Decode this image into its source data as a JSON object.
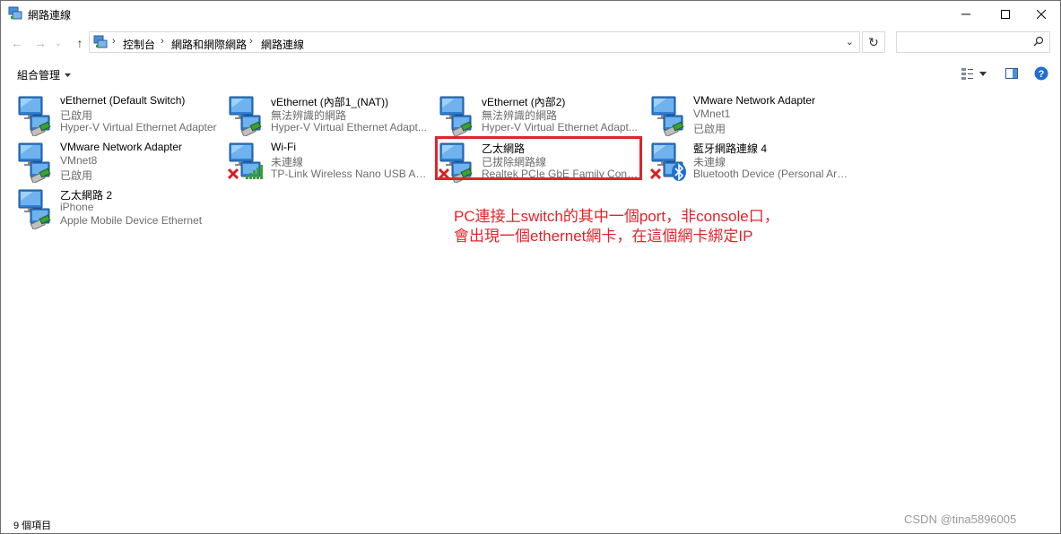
{
  "window": {
    "title": "網路連線",
    "minimize_icon": "minimize-icon",
    "maximize_icon": "maximize-icon",
    "close_icon": "close-icon"
  },
  "address_bar": {
    "breadcrumbs": [
      "控制台",
      "網路和網際網路",
      "網路連線"
    ],
    "search_placeholder": ""
  },
  "toolbar": {
    "organize_label": "組合管理"
  },
  "connections": [
    {
      "name": "vEthernet (Default Switch)",
      "status": "已啟用",
      "device": "Hyper-V Virtual Ethernet Adapter",
      "type": "ethernet",
      "overlay": ""
    },
    {
      "name": "vEthernet (內部1_(NAT))",
      "status": "無法辨識的網路",
      "device": "Hyper-V Virtual Ethernet Adapt...",
      "type": "ethernet",
      "overlay": ""
    },
    {
      "name": "vEthernet (內部2)",
      "status": "無法辨識的網路",
      "device": "Hyper-V Virtual Ethernet Adapt...",
      "type": "ethernet",
      "overlay": ""
    },
    {
      "name": "VMware Network Adapter",
      "status": "VMnet1",
      "device": "已啟用",
      "type": "ethernet",
      "overlay": ""
    },
    {
      "name": "VMware Network Adapter",
      "status": "VMnet8",
      "device": "已啟用",
      "type": "ethernet",
      "overlay": ""
    },
    {
      "name": "Wi-Fi",
      "status": "未連線",
      "device": "TP-Link Wireless Nano USB Ada...",
      "type": "wifi",
      "overlay": "x"
    },
    {
      "name": "乙太網路",
      "status": "已拔除網路線",
      "device": "Realtek PCIe GbE Family Contro...",
      "type": "ethernet",
      "overlay": "x"
    },
    {
      "name": "藍牙網路連線 4",
      "status": "未連線",
      "device": "Bluetooth Device (Personal Are...",
      "type": "bluetooth",
      "overlay": "x"
    },
    {
      "name": "乙太網路 2",
      "status": "iPhone",
      "device": "Apple Mobile Device Ethernet",
      "type": "ethernet",
      "overlay": ""
    }
  ],
  "annotation": {
    "line1": "PC連接上switch的其中一個port，非console口，",
    "line2": "會出現一個ethernet網卡，在這個網卡綁定IP"
  },
  "status_bar": {
    "item_count": "9 個項目"
  },
  "watermark": "CSDN @tina5896005",
  "colors": {
    "annotation": "#e0242a",
    "secondary_text": "#6d6d6d",
    "help": "#1f6fd1"
  }
}
